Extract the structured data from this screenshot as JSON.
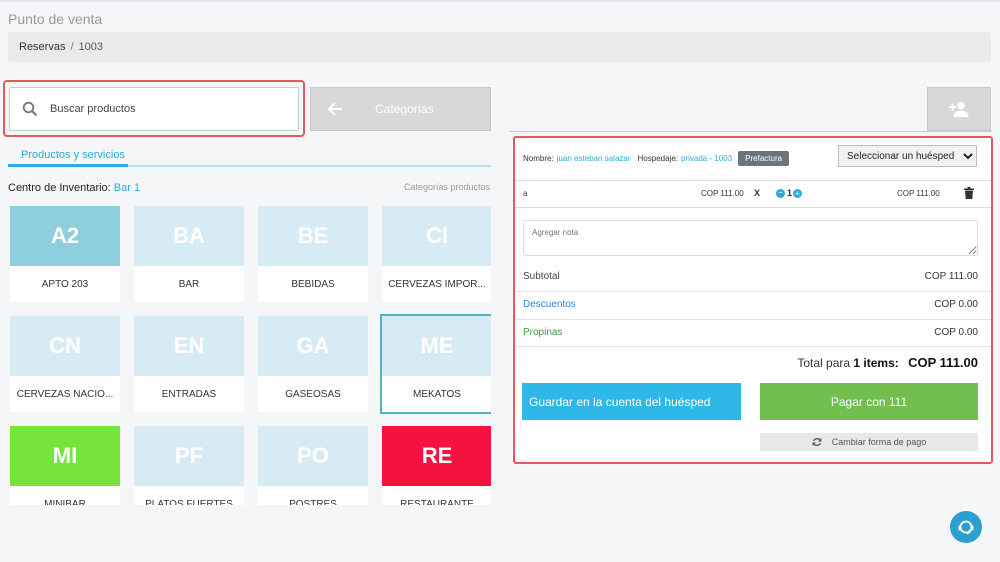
{
  "header": {
    "page_title": "Punto de venta",
    "breadcrumb": {
      "parent": "Reservas",
      "separator": "/",
      "current": "1003"
    }
  },
  "toolbar": {
    "search_placeholder": "Buscar productos",
    "categories_label": "Categorías"
  },
  "tabs": [
    {
      "label": "Productos y servicios",
      "active": true
    }
  ],
  "inventory": {
    "label": "Centro de Inventario:",
    "value": "Bar 1",
    "categories_link": "Categorías productos"
  },
  "categories": [
    {
      "code": "A2",
      "name": "APTO 203",
      "color": "#8ecfdd"
    },
    {
      "code": "BA",
      "name": "BAR",
      "color": "#d7ebf5"
    },
    {
      "code": "BE",
      "name": "BEBIDAS",
      "color": "#d7ebf5"
    },
    {
      "code": "CI",
      "name": "CERVEZAS IMPOR...",
      "color": "#d7ebf5"
    },
    {
      "code": "CN",
      "name": "CERVEZAS NACIO...",
      "color": "#d7ebf5"
    },
    {
      "code": "EN",
      "name": "ENTRADAS",
      "color": "#d7ebf5"
    },
    {
      "code": "GA",
      "name": "GASEOSAS",
      "color": "#d7ebf5"
    },
    {
      "code": "ME",
      "name": "MEKATOS",
      "color": "#d7ebf5",
      "selected": true
    },
    {
      "code": "MI",
      "name": "MINIBAR",
      "color": "#77e43c"
    },
    {
      "code": "PF",
      "name": "PLATOS FUERTES",
      "color": "#d7ebf5"
    },
    {
      "code": "PO",
      "name": "POSTRES",
      "color": "#d7ebf5"
    },
    {
      "code": "RE",
      "name": "RESTAURANTE",
      "color": "#f5123f"
    }
  ],
  "order": {
    "name_label": "Nombre:",
    "name_value": "juan esteban salazar",
    "lodging_label": "Hospedaje:",
    "lodging_value": "privada - 1003",
    "prefactura_label": "Prefactura",
    "guest_select": "Seleccionar un huésped",
    "item": {
      "name": "a",
      "price": "COP 111.00",
      "times": "X",
      "minus": "−",
      "qty": "1",
      "plus": "+",
      "total": "COP 111.00"
    },
    "note_placeholder": "Agregar nota",
    "subtotal_label": "Subtotal",
    "subtotal_value": "COP 111.00",
    "discounts_label": "Descuentos",
    "discounts_value": "COP 0.00",
    "tips_label": "Propinas",
    "tips_value": "COP 0.00",
    "total_prefix": "Total para",
    "total_items": "1 items:",
    "total_value": "COP 111.00",
    "save_label": "Guardar en la cuenta del huésped",
    "pay_label": "Pagar con 111",
    "change_payment_label": "Cambiar forma de pago"
  },
  "colors": {
    "accent": "#2eabd8",
    "highlight": "#e25a5f",
    "pay": "#72bf4f",
    "save": "#2eb8e8"
  }
}
